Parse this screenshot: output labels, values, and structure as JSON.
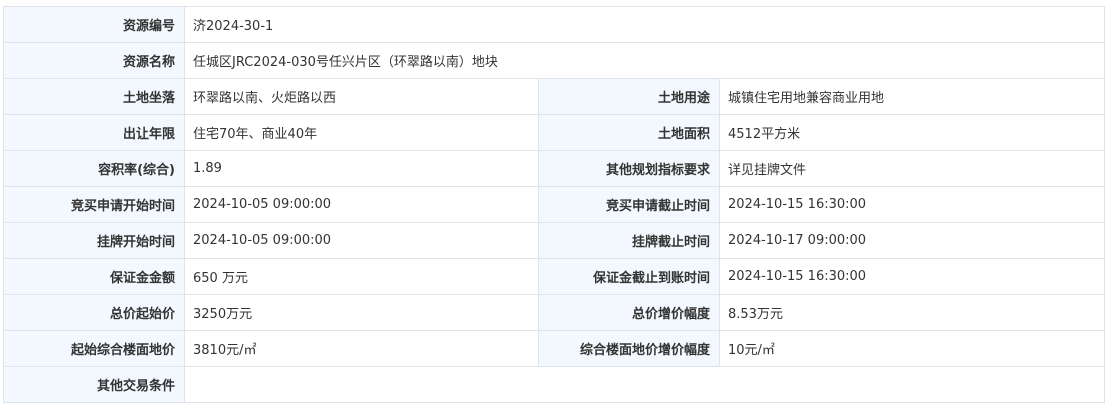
{
  "rows": [
    {
      "label": "资源编号",
      "value": "济2024-30-1"
    },
    {
      "label": "资源名称",
      "value": "任城区JRC2024-030号任兴片区（环翠路以南）地块"
    },
    {
      "label": "土地坐落",
      "value": "环翠路以南、火炬路以西",
      "label2": "土地用途",
      "value2": "城镇住宅用地兼容商业用地"
    },
    {
      "label": "出让年限",
      "value": "住宅70年、商业40年",
      "label2": "土地面积",
      "value2": "4512平方米"
    },
    {
      "label": "容积率(综合)",
      "value": "1.89",
      "label2": "其他规划指标要求",
      "value2": "详见挂牌文件"
    },
    {
      "label": "竞买申请开始时间",
      "value": "2024-10-05 09:00:00",
      "label2": "竞买申请截止时间",
      "value2": "2024-10-15 16:30:00"
    },
    {
      "label": "挂牌开始时间",
      "value": "2024-10-05 09:00:00",
      "label2": "挂牌截止时间",
      "value2": "2024-10-17 09:00:00"
    },
    {
      "label": "保证金金额",
      "value": "650 万元",
      "label2": "保证金截止到账时间",
      "value2": "2024-10-15 16:30:00"
    },
    {
      "label": "总价起始价",
      "value": "3250万元",
      "label2": "总价增价幅度",
      "value2": "8.53万元"
    },
    {
      "label": "起始综合楼面地价",
      "value": "3810元/㎡",
      "label2": "综合楼面地价增价幅度",
      "value2": "10元/㎡"
    },
    {
      "label": "其他交易条件",
      "value": ""
    }
  ]
}
